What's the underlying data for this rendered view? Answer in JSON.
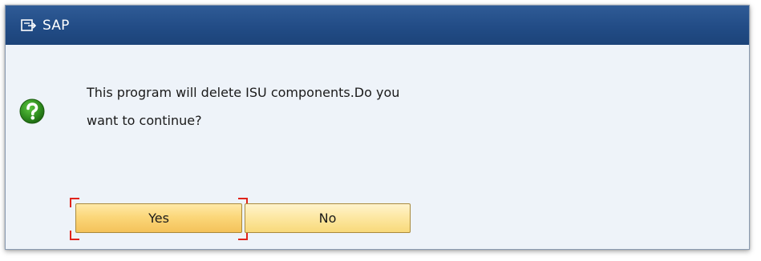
{
  "window": {
    "title": "SAP",
    "title_icon": "window-menu-icon"
  },
  "message": {
    "icon": "question-icon",
    "line1": "This program will delete ISU components.Do you",
    "line2": "want to continue?"
  },
  "buttons": {
    "yes_label": "Yes",
    "no_label": "No",
    "focused": "yes"
  },
  "colors": {
    "titlebar": "#224c86",
    "dialog_bg": "#eef3f9",
    "button_bg": "#fde8a4",
    "focus_marker": "#e0241b",
    "question_icon": "#2e8b1e"
  }
}
